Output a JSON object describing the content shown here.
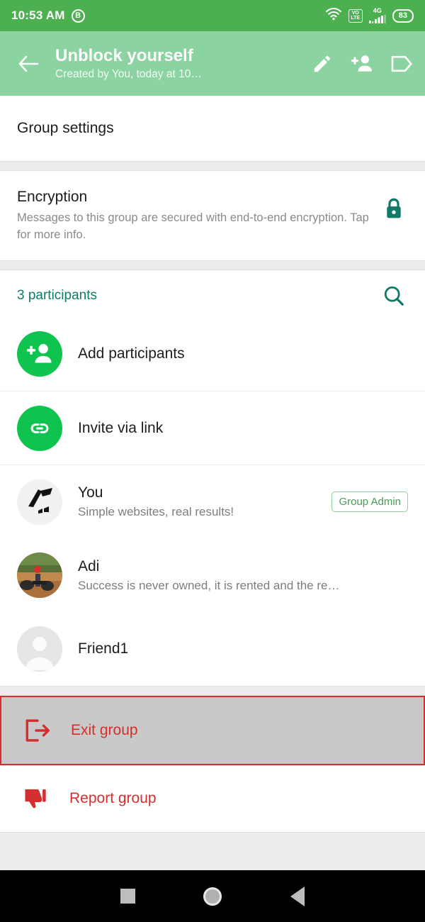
{
  "statusbar": {
    "time": "10:53 AM",
    "app_badge": "B",
    "wifi_icon": "wifi-icon",
    "volte_top": "VO",
    "volte_bottom": "LTE",
    "network_label": "4G",
    "signal_icon": "signal-bars-icon",
    "battery_level": "83",
    "bg_color": "#4CAF50"
  },
  "toolbar": {
    "back_icon": "arrow-left-icon",
    "title": "Unblock yourself",
    "subtitle": "Created by You, today at 10…",
    "edit_icon": "pencil-icon",
    "add_person_icon": "add-person-icon",
    "label_icon": "tag-icon",
    "bg_color": "#8BD3A0"
  },
  "group_settings": {
    "label": "Group settings"
  },
  "encryption": {
    "title": "Encryption",
    "description": "Messages to this group are secured with end-to-end encryption. Tap for more info.",
    "lock_icon": "lock-icon",
    "accent_color": "#0f7a68"
  },
  "participants": {
    "count_label": "3 participants",
    "search_icon": "search-icon",
    "accent_color": "#0f7a68",
    "actions": [
      {
        "label": "Add participants",
        "icon": "add-person-icon"
      },
      {
        "label": "Invite via link",
        "icon": "link-icon"
      }
    ],
    "members": [
      {
        "name": "You",
        "status": "Simple websites, real results!",
        "badge": "Group Admin",
        "avatar": "logo-avatar"
      },
      {
        "name": "Adi",
        "status": "Success is never owned, it is rented and the re…",
        "badge": "",
        "avatar": "photo-avatar"
      },
      {
        "name": "Friend1",
        "status": "",
        "badge": "",
        "avatar": "default-person-avatar"
      }
    ]
  },
  "destructive": {
    "exit": {
      "label": "Exit group",
      "icon": "exit-icon",
      "selected": true
    },
    "report": {
      "label": "Report group",
      "icon": "thumbs-down-icon"
    },
    "color": "#d32f2f",
    "highlight_bg": "#c9c9c9"
  },
  "navbar": {
    "recents_icon": "recents-square-icon",
    "home_icon": "home-circle-icon",
    "back_icon": "back-triangle-icon"
  }
}
